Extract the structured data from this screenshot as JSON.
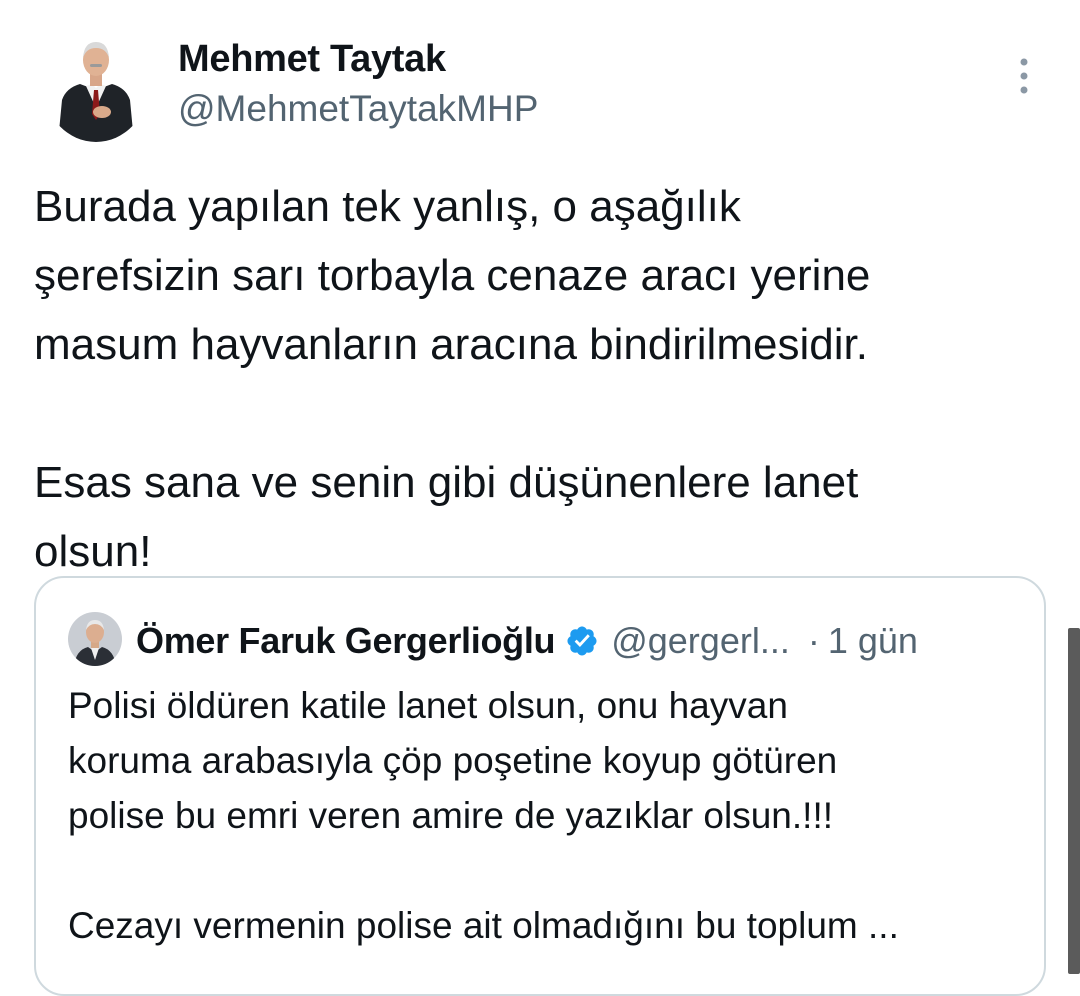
{
  "tweet": {
    "author_name": "Mehmet Taytak",
    "author_handle": "@MehmetTaytakMHP",
    "avatar_icon": "user-avatar",
    "more_icon": "more-vertical-icon",
    "body_lines": [
      "Burada yapılan tek yanlış, o aşağılık",
      "şerefsizin sarı torbayla cenaze aracı yerine",
      "masum hayvanların aracına bindirilmesidir.",
      "",
      "Esas sana ve senin gibi düşünenlere lanet",
      "olsun!"
    ]
  },
  "quote": {
    "author_name": "Ömer Faruk Gergerlioğlu",
    "verified_icon": "verified-badge-icon",
    "author_handle": "@gergerl...",
    "separator": "·",
    "time": "1 gün",
    "body_lines": [
      "Polisi öldüren katile lanet olsun, onu hayvan",
      "koruma arabasıyla çöp poşetine koyup götüren",
      "polise bu emri veren amire de yazıklar olsun.!!!",
      "",
      "Cezayı vermenin polise ait olmadığını bu toplum ..."
    ]
  },
  "colors": {
    "text_primary": "#0f1419",
    "text_secondary": "#536471",
    "border": "#cfd9de",
    "verified": "#1d9bf0"
  }
}
